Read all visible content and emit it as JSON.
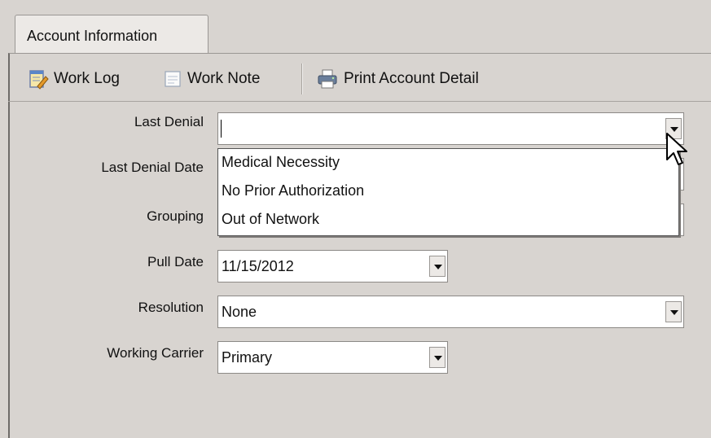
{
  "tabs": [
    {
      "label": "Account Information"
    }
  ],
  "toolbar": {
    "work_log": "Work Log",
    "work_note": "Work Note",
    "print_detail": "Print Account Detail"
  },
  "form": {
    "last_denial": {
      "label": "Last Denial",
      "value": ""
    },
    "last_denial_date": {
      "label": "Last Denial Date"
    },
    "grouping": {
      "label": "Grouping"
    },
    "pull_date": {
      "label": "Pull Date",
      "value": "11/15/2012"
    },
    "resolution": {
      "label": "Resolution",
      "value": "None"
    },
    "working_carrier": {
      "label": "Working Carrier",
      "value": "Primary"
    }
  },
  "dropdown": {
    "options": [
      "Medical Necessity",
      "No Prior Authorization",
      "Out of Network"
    ]
  },
  "icons": {
    "work_log": "notepad-pencil-icon",
    "work_note": "note-icon",
    "print": "printer-icon",
    "dropdown": "chevron-down-icon",
    "cursor": "mouse-pointer-icon"
  }
}
